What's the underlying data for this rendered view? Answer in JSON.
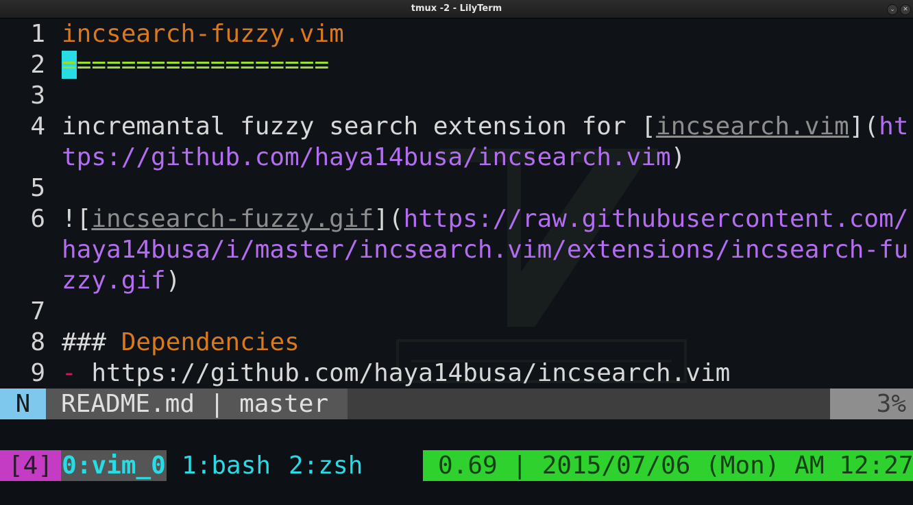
{
  "window": {
    "title": "tmux -2 - LilyTerm",
    "minimize_glyph": "⌄",
    "close_glyph": "✕"
  },
  "colors": {
    "orange": "#d9791d",
    "green": "#9ae02a",
    "purple": "#b36ef0",
    "cyan": "#28dce6",
    "magenta": "#c43bc4",
    "status_green": "#2fd12f",
    "mode_blue": "#7ec8ee"
  },
  "editor": {
    "numbers": [
      "1",
      "2",
      "3",
      "4",
      "5",
      "6",
      "7",
      "8",
      "9"
    ],
    "line1": "incsearch-fuzzy.vim",
    "line2_cursor": "=",
    "line2_rest": "=================",
    "line4_text": "incremantal fuzzy search extension for [",
    "line4_link": "incsearch.vim",
    "line4_close": "](",
    "line4_url": "ht",
    "line4_wrap": "tps://github.com/haya14busa/incsearch.vim",
    "line4_paren": ")",
    "line6_open": "![",
    "line6_link": "incsearch-fuzzy.gif",
    "line6_close": "](",
    "line6_url": "https://raw.githubusercontent.com/",
    "line6_wrap1": "haya14busa/i/master/incsearch.vim/extensions/incsearch-fu",
    "line6_wrap2": "zzy.gif",
    "line6_paren": ")",
    "line8_hash": "### ",
    "line8_heading": "Dependencies",
    "line9_dash": "-",
    "line9_text": " https://github.com/haya14busa/incsearch.vim"
  },
  "statusline": {
    "mode": "N",
    "file": "README.md | master",
    "percent": "3%"
  },
  "tmux": {
    "session": "[4]",
    "active_window": "0:vim_0",
    "window1": "1:bash",
    "window2": "2:zsh",
    "status": "0.69 | 2015/07/06 (Mon) AM 12:27"
  },
  "icons": {
    "minimize": "chevron-down-icon",
    "close": "close-icon"
  }
}
